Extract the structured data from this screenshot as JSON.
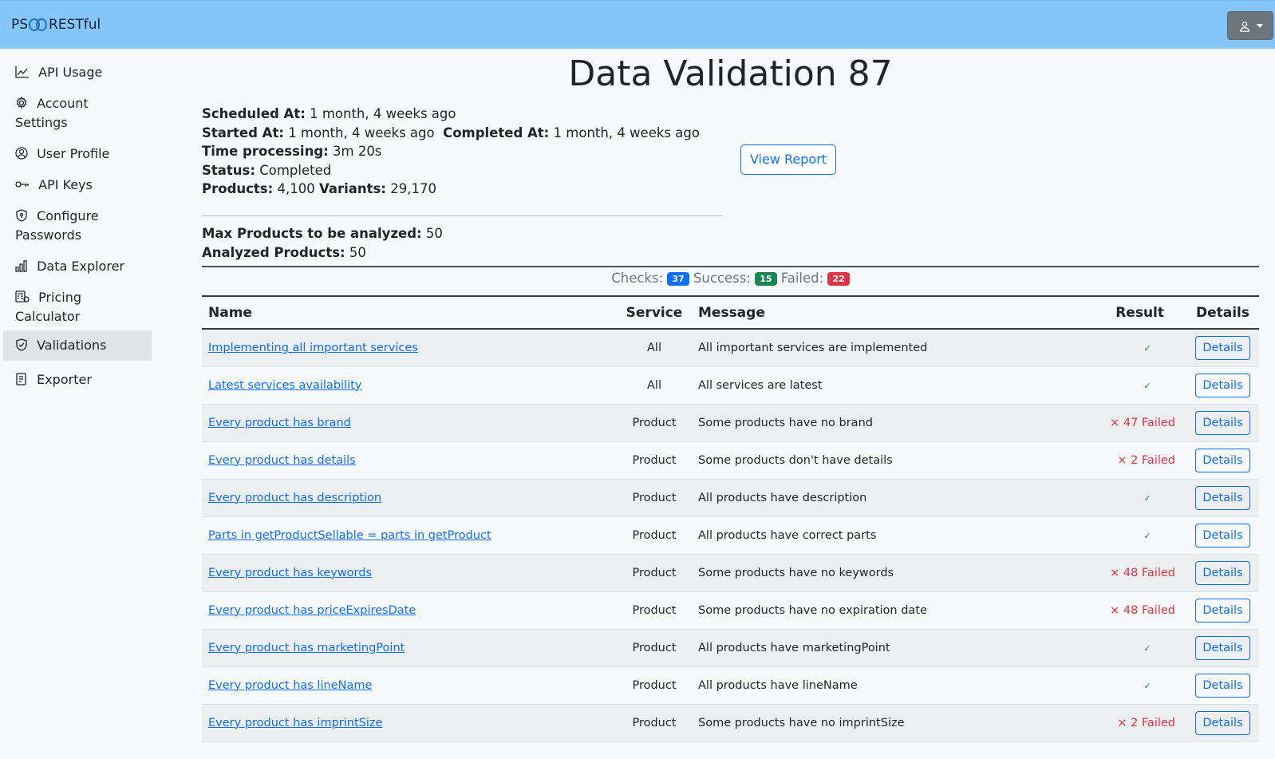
{
  "header": {
    "brand_left": "PS",
    "brand_right": "RESTful",
    "user_icon": "user-icon"
  },
  "sidebar": {
    "items": [
      {
        "label": "API Usage",
        "icon": "chart-line-icon"
      },
      {
        "label": "Account Settings",
        "icon": "gear-icon"
      },
      {
        "label": "User Profile",
        "icon": "user-circle-icon"
      },
      {
        "label": "API Keys",
        "icon": "key-icon"
      },
      {
        "label": "Configure Passwords",
        "icon": "shield-lock-icon"
      },
      {
        "label": "Data Explorer",
        "icon": "bar-chart-icon"
      },
      {
        "label": "Pricing Calculator",
        "icon": "calculator-icon"
      },
      {
        "label": "Validations",
        "icon": "shield-check-icon",
        "active": true
      },
      {
        "label": "Exporter",
        "icon": "file-export-icon"
      }
    ]
  },
  "page": {
    "title": "Data Validation 87",
    "scheduled_label": "Scheduled At:",
    "scheduled_value": "1 month, 4 weeks ago",
    "started_label": "Started At:",
    "started_value": "1 month, 4 weeks ago",
    "completed_label": "Completed At:",
    "completed_value": "1 month, 4 weeks ago",
    "time_label": "Time processing:",
    "time_value": "3m 20s",
    "status_label": "Status:",
    "status_value": "Completed",
    "products_label": "Products:",
    "products_value": "4,100",
    "variants_label": "Variants:",
    "variants_value": "29,170",
    "max_label": "Max Products to be analyzed:",
    "max_value": "50",
    "analyzed_label": "Analyzed Products:",
    "analyzed_value": "50",
    "view_report": "View Report"
  },
  "summary": {
    "checks_label": "Checks:",
    "checks": "37",
    "success_label": "Success:",
    "success": "15",
    "failed_label": "Failed:",
    "failed": "22"
  },
  "table": {
    "headers": {
      "name": "Name",
      "service": "Service",
      "message": "Message",
      "result": "Result",
      "details": "Details"
    },
    "rows": [
      {
        "name": "Implementing all important services",
        "service": "All",
        "message": "All important services are implemented",
        "result": "✓",
        "ok": true,
        "details": "Details"
      },
      {
        "name": "Latest services availability",
        "service": "All",
        "message": "All services are latest",
        "result": "✓",
        "ok": true,
        "details": "Details"
      },
      {
        "name": "Every product has brand",
        "service": "Product",
        "message": "Some products have no brand",
        "result": "× 47 Failed",
        "ok": false,
        "details": "Details"
      },
      {
        "name": "Every product has details",
        "service": "Product",
        "message": "Some products don't have details",
        "result": "× 2 Failed",
        "ok": false,
        "details": "Details"
      },
      {
        "name": "Every product has description",
        "service": "Product",
        "message": "All products have description",
        "result": "✓",
        "ok": true,
        "details": "Details"
      },
      {
        "name": "Parts in getProductSellable = parts in getProduct",
        "service": "Product",
        "message": "All products have correct parts",
        "result": "✓",
        "ok": true,
        "details": "Details"
      },
      {
        "name": "Every product has keywords",
        "service": "Product",
        "message": "Some products have no keywords",
        "result": "× 48 Failed",
        "ok": false,
        "details": "Details"
      },
      {
        "name": "Every product has priceExpiresDate",
        "service": "Product",
        "message": "Some products have no expiration date",
        "result": "× 48 Failed",
        "ok": false,
        "details": "Details"
      },
      {
        "name": "Every product has marketingPoint",
        "service": "Product",
        "message": "All products have marketingPoint",
        "result": "✓",
        "ok": true,
        "details": "Details"
      },
      {
        "name": "Every product has lineName",
        "service": "Product",
        "message": "All products have lineName",
        "result": "✓",
        "ok": true,
        "details": "Details"
      },
      {
        "name": "Every product has imprintSize",
        "service": "Product",
        "message": "Some products have no imprintSize",
        "result": "× 2 Failed",
        "ok": false,
        "details": "Details"
      }
    ]
  }
}
